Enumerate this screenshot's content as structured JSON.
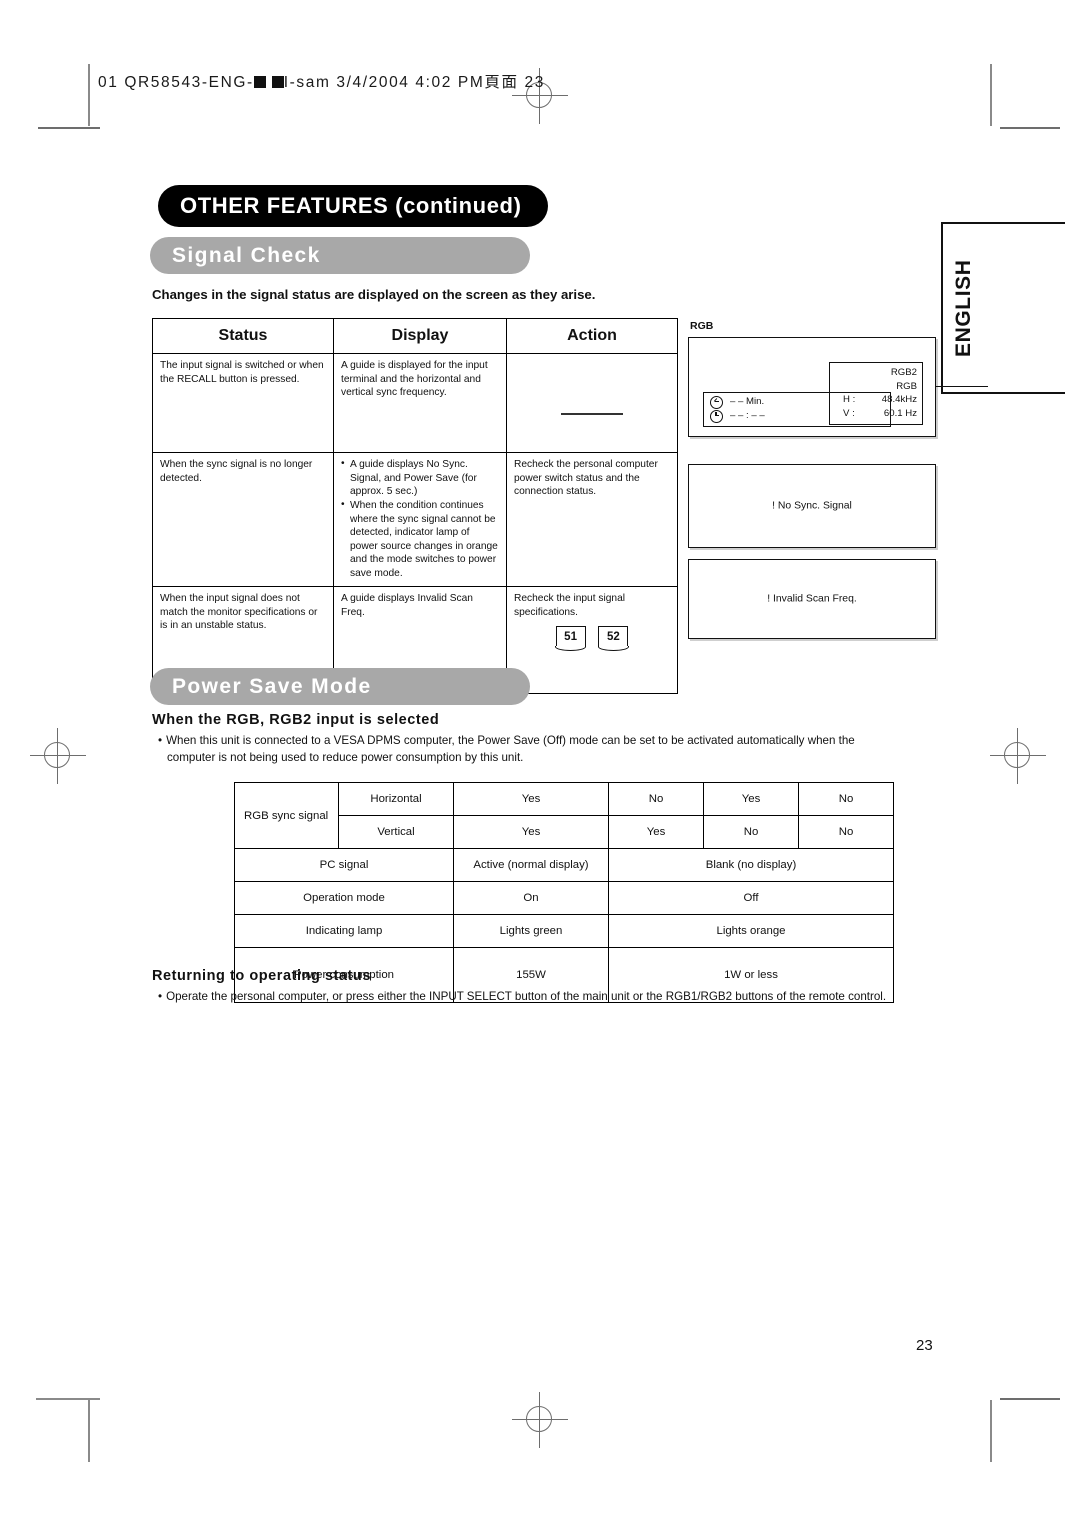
{
  "slug": {
    "text_before": "01 QR58543-ENG-",
    "text_mid": "I-sam  3/4/2004  4:02 PM",
    "text_cjk": "頁面",
    "text_after": "23"
  },
  "chapter": {
    "title": "OTHER FEATURES (continued)"
  },
  "language_tab": {
    "label": "ENGLISH"
  },
  "signal_check": {
    "section_title": "Signal Check",
    "lead": "Changes in the signal status are displayed on the screen as they arise.",
    "columns": [
      "Status",
      "Display",
      "Action"
    ],
    "rows": [
      {
        "status": "The input signal is switched or when the RECALL button is pressed.",
        "display_paragraph": "A guide is displayed for the input terminal and the horizontal and vertical sync frequency.",
        "display_bullets": [],
        "action": "",
        "action_is_dash": true,
        "page_refs": []
      },
      {
        "status": "When the sync signal is no longer detected.",
        "display_paragraph": "",
        "display_bullets": [
          "A guide displays No Sync. Signal, and Power Save (for approx. 5 sec.)",
          "When the condition continues where the sync signal cannot be detected, indicator lamp of power source changes in orange and the mode switches to power save mode."
        ],
        "action": "Recheck the personal computer power switch status and the connection status.",
        "action_is_dash": false,
        "page_refs": []
      },
      {
        "status": "When the input signal does not match the monitor specifications or is in an unstable status.",
        "display_paragraph": "A guide displays Invalid Scan Freq.",
        "display_bullets": [],
        "action": "Recheck the input signal specifications.",
        "action_is_dash": false,
        "page_refs": [
          "51",
          "52"
        ]
      }
    ]
  },
  "osd_panels": {
    "rgb_label": "RGB",
    "panel1": {
      "info": {
        "line1": "RGB2",
        "line2": "RGB",
        "h_key": "H :",
        "h_value": "48.4kHz",
        "v_key": "V :",
        "v_value": "60.1 Hz"
      },
      "timer": {
        "line1": "– – Min.",
        "line2": "– – : – –"
      }
    },
    "panel2": {
      "message": "! No Sync. Signal"
    },
    "panel3": {
      "message": "! Invalid Scan Freq."
    }
  },
  "power_save": {
    "section_title": "Power Save Mode",
    "subhead": "When the RGB, RGB2 input is selected",
    "bullet_line1": "When this unit is connected to a VESA DPMS computer, the Power Save (Off) mode can be set to be activated automatically when the",
    "bullet_line2": "computer is not being used to reduce power consumption by this unit.",
    "table": {
      "rgb_sync_label": "RGB sync signal",
      "horizontal_label": "Horizontal",
      "vertical_label": "Vertical",
      "horizontal_values": [
        "Yes",
        "No",
        "Yes",
        "No"
      ],
      "vertical_values": [
        "Yes",
        "Yes",
        "No",
        "No"
      ],
      "pc_signal_label": "PC signal",
      "pc_signal_active": "Active (normal display)",
      "pc_signal_blank": "Blank (no display)",
      "operation_mode_label": "Operation mode",
      "operation_mode_on": "On",
      "operation_mode_off": "Off",
      "indicating_lamp_label": "Indicating lamp",
      "indicating_lamp_green": "Lights green",
      "indicating_lamp_orange": "Lights orange",
      "power_consumption_label": "Power consumption",
      "power_consumption_on": "155W",
      "power_consumption_off": "1W or less"
    }
  },
  "returning": {
    "subhead": "Returning to operating status",
    "bullet": "Operate the personal computer, or press either the INPUT SELECT button of the main unit or the RGB1/RGB2 buttons of the remote control."
  },
  "footer": {
    "page_number": "23"
  }
}
